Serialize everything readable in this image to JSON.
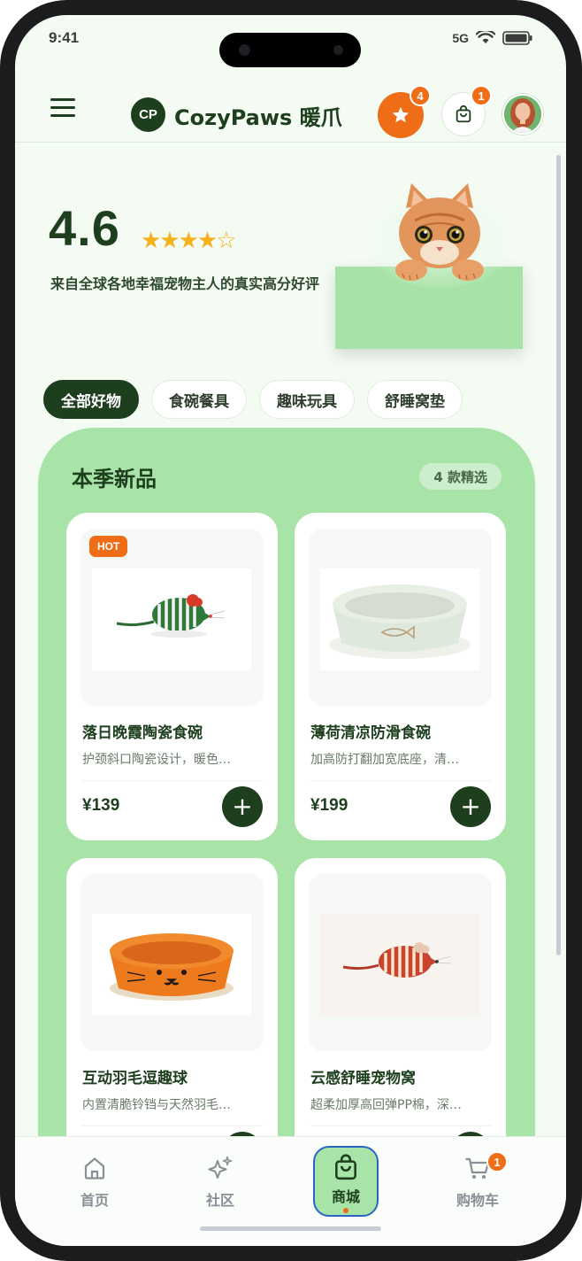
{
  "status": {
    "time": "9:41",
    "network": "5G"
  },
  "header": {
    "logo_initials": "CP",
    "brand": "CozyPaws 暖爪",
    "favorites_count": "4",
    "cart_count": "1"
  },
  "hero": {
    "rating": "4.6",
    "stars": "★★★★☆",
    "caption": "来自全球各地幸福宠物主人的真实高分好评"
  },
  "categories": [
    "全部好物",
    "食碗餐具",
    "趣味玩具",
    "舒睡窝垫"
  ],
  "section": {
    "title": "本季新品",
    "count": "4 款精选"
  },
  "products": [
    {
      "tag": "HOT",
      "name": "落日晚霞陶瓷食碗",
      "desc": "护颈斜口陶瓷设计，暖色…",
      "price": "¥139",
      "add": "+"
    },
    {
      "tag": "",
      "name": "薄荷清凉防滑食碗",
      "desc": "加高防打翻加宽底座，清…",
      "price": "¥199",
      "add": "+"
    },
    {
      "tag": "",
      "name": "互动羽毛逗趣球",
      "desc": "内置清脆铃铛与天然羽毛…",
      "price": "",
      "add": "+"
    },
    {
      "tag": "",
      "name": "云感舒睡宠物窝",
      "desc": "超柔加厚高回弹PP棉，深…",
      "price": "",
      "add": "+"
    }
  ],
  "tabbar": [
    {
      "label": "首页",
      "icon": "home-icon"
    },
    {
      "label": "社区",
      "icon": "sparkle-icon"
    },
    {
      "label": "商城",
      "icon": "shopping-bag-icon",
      "active": true
    },
    {
      "label": "购物车",
      "icon": "cart-icon",
      "badge": "1"
    }
  ],
  "colors": {
    "brand_green": "#1e3f1e",
    "accent_orange": "#ef6d16",
    "panel_green": "#a8e3a8"
  }
}
